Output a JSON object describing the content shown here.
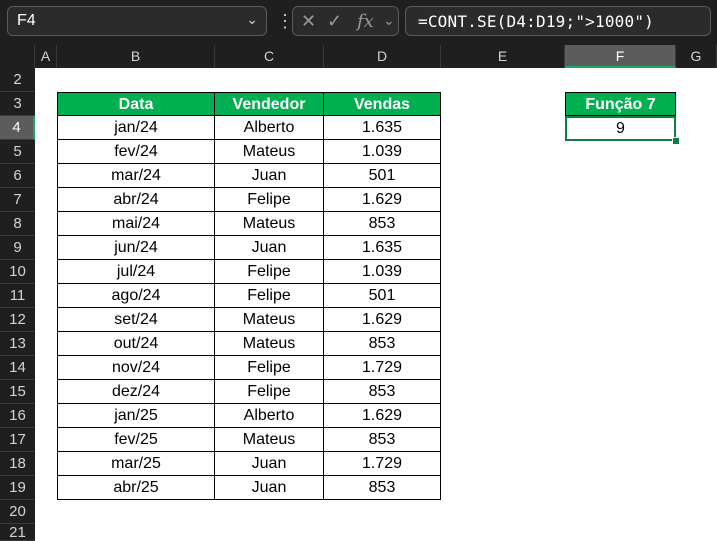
{
  "name_box": "F4",
  "formula": "=CONT.SE(D4:D19;\">1000\")",
  "columns": [
    "A",
    "B",
    "C",
    "D",
    "E",
    "F",
    "G"
  ],
  "rows": [
    "2",
    "3",
    "4",
    "5",
    "6",
    "7",
    "8",
    "9",
    "10",
    "11",
    "12",
    "13",
    "14",
    "15",
    "16",
    "17",
    "18",
    "19",
    "20",
    "21"
  ],
  "selected_column": "F",
  "selected_row": "4",
  "table": {
    "headers": [
      "Data",
      "Vendedor",
      "Vendas"
    ],
    "rows": [
      [
        "jan/24",
        "Alberto",
        "1.635"
      ],
      [
        "fev/24",
        "Mateus",
        "1.039"
      ],
      [
        "mar/24",
        "Juan",
        "501"
      ],
      [
        "abr/24",
        "Felipe",
        "1.629"
      ],
      [
        "mai/24",
        "Mateus",
        "853"
      ],
      [
        "jun/24",
        "Juan",
        "1.635"
      ],
      [
        "jul/24",
        "Felipe",
        "1.039"
      ],
      [
        "ago/24",
        "Felipe",
        "501"
      ],
      [
        "set/24",
        "Mateus",
        "1.629"
      ],
      [
        "out/24",
        "Mateus",
        "853"
      ],
      [
        "nov/24",
        "Felipe",
        "1.729"
      ],
      [
        "dez/24",
        "Felipe",
        "853"
      ],
      [
        "jan/25",
        "Alberto",
        "1.629"
      ],
      [
        "fev/25",
        "Mateus",
        "853"
      ],
      [
        "mar/25",
        "Juan",
        "1.729"
      ],
      [
        "abr/25",
        "Juan",
        "853"
      ]
    ]
  },
  "result": {
    "header": "Função 7",
    "value": "9"
  },
  "colors": {
    "header_green": "#00b050",
    "selection_green": "#107c41"
  }
}
